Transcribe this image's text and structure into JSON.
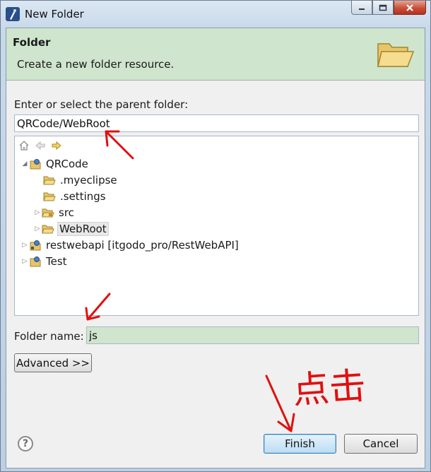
{
  "window": {
    "title": "New Folder"
  },
  "banner": {
    "title": "Folder",
    "message": "Create a new folder resource."
  },
  "parent": {
    "label": "Enter or select the parent folder:",
    "value": "QRCode/WebRoot"
  },
  "tree": {
    "items": [
      {
        "label": "QRCode",
        "icon": "project-icon",
        "expanded": true
      },
      {
        "label": ".myeclipse",
        "icon": "folder-icon"
      },
      {
        "label": ".settings",
        "icon": "folder-icon"
      },
      {
        "label": "src",
        "icon": "package-folder-icon"
      },
      {
        "label": "WebRoot",
        "icon": "folder-open-icon",
        "selected": true
      },
      {
        "label": "restwebapi [itgodo_pro/RestWebAPI]",
        "icon": "project-icon"
      },
      {
        "label": "Test",
        "icon": "project-icon"
      }
    ]
  },
  "folder_name": {
    "label": "Folder name:",
    "value": "js"
  },
  "buttons": {
    "advanced": "Advanced >>",
    "finish": "Finish",
    "cancel": "Cancel"
  },
  "annotation": {
    "text": "点击",
    "color": "#e01010"
  },
  "colors": {
    "banner_bg": "#cfe5cd",
    "finish_border": "#3c7fb1"
  }
}
